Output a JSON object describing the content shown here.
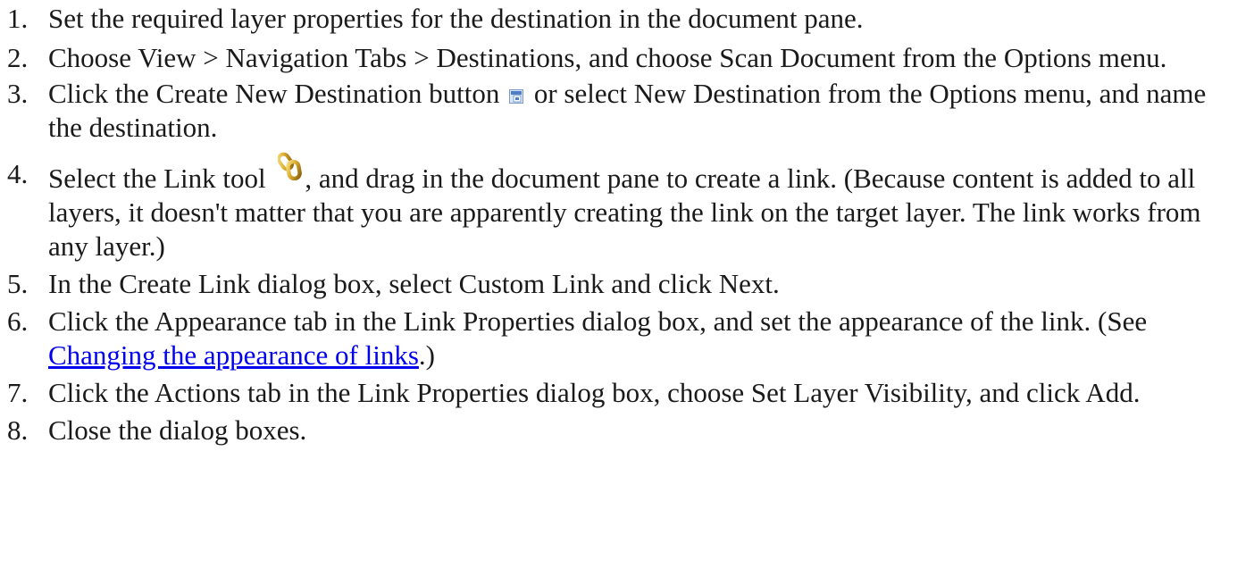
{
  "steps": [
    {
      "number": "1.",
      "text": "Set the required layer properties for the destination in the document pane."
    },
    {
      "number": "2.",
      "text": "Choose View > Navigation Tabs > Destinations, and choose Scan Document from the Options menu."
    },
    {
      "number": "3.",
      "text_before_icon": "Click the Create New Destination button ",
      "icon": "create-new-destination-icon",
      "text_after_icon": " or select New Destination from the Options menu, and name the destination."
    },
    {
      "number": "4.",
      "text_before_icon": "Select the Link tool ",
      "icon": "link-tool-icon",
      "text_after_icon": ", and drag in the document pane to create a link. (Because content is added to all layers, it doesn't matter that you are apparently creating the link on the target layer. The link works from any layer.)"
    },
    {
      "number": "5.",
      "text": "In the Create Link dialog box, select Custom Link and click Next."
    },
    {
      "number": "6.",
      "text_before_link": "Click the Appearance tab in the Link Properties dialog box, and set the appearance of the link. (See ",
      "link_text": "Changing the appearance of links",
      "text_after_link": ".)"
    },
    {
      "number": "7.",
      "text": "Click the Actions tab in the Link Properties dialog box, choose Set Layer Visibility, and click Add."
    },
    {
      "number": "8.",
      "text": "Close the dialog boxes."
    }
  ],
  "colors": {
    "text": "#1a1a1a",
    "link": "#0000ee",
    "background": "#ffffff"
  }
}
